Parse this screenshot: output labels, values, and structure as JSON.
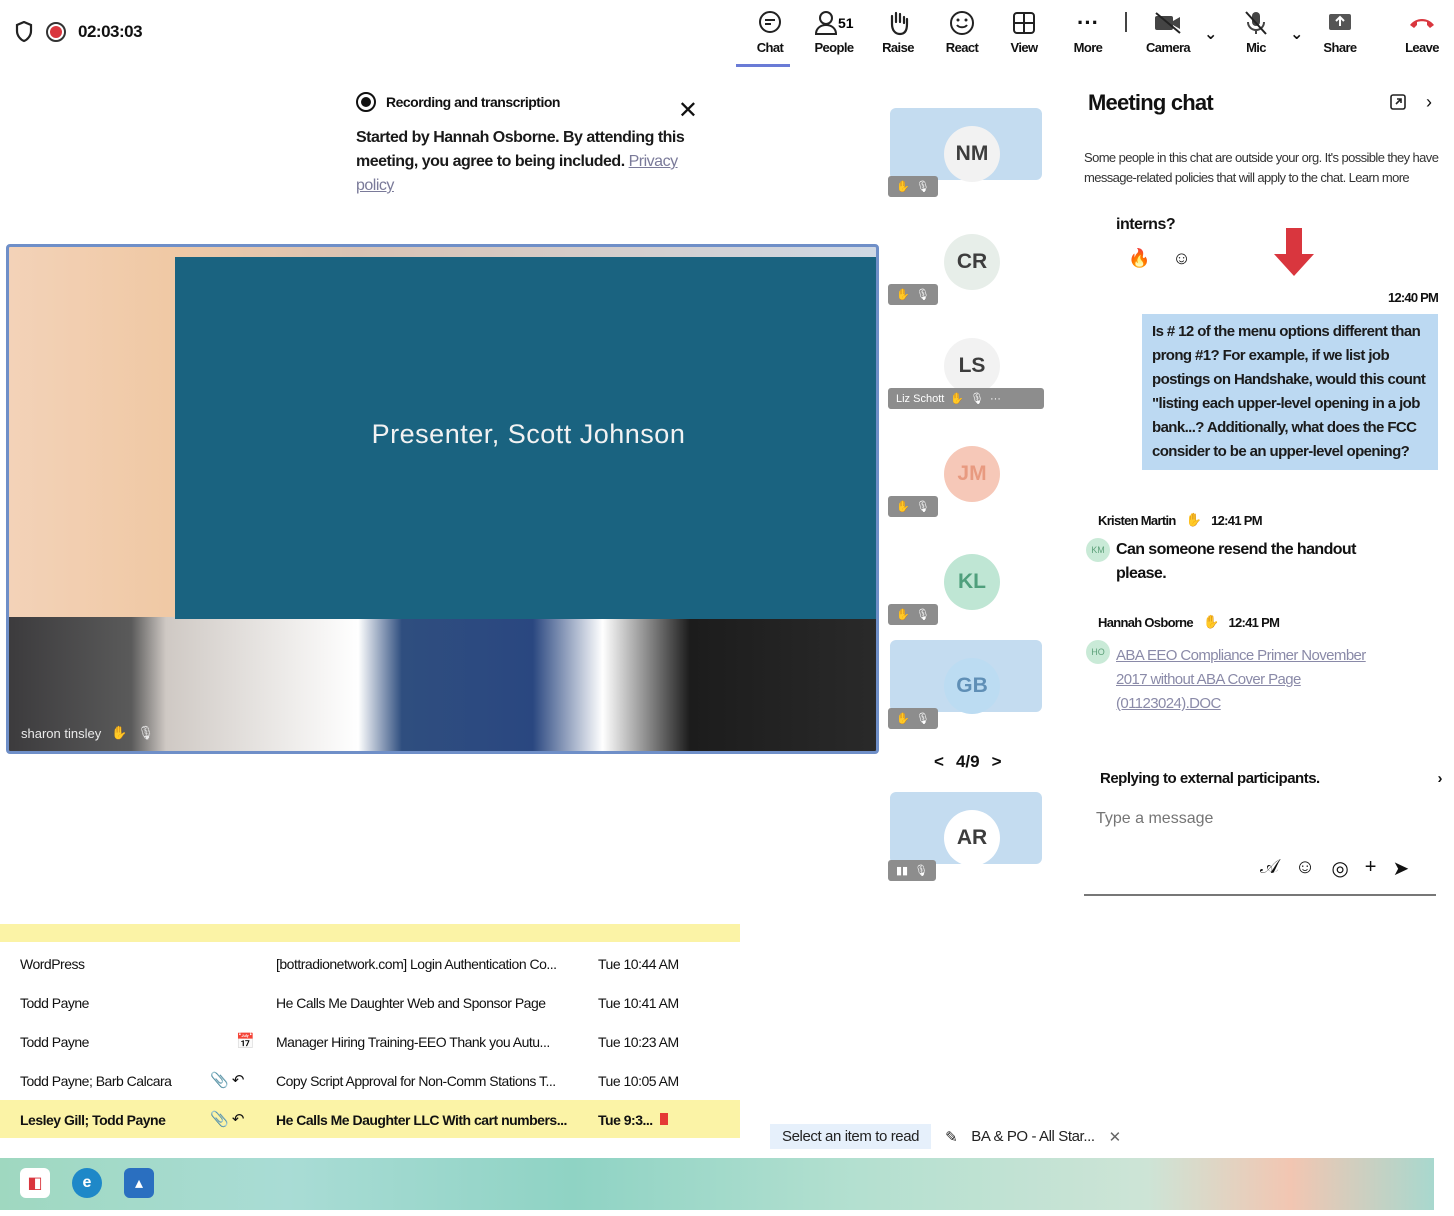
{
  "topbar": {
    "timer": "02:03:03",
    "buttons": [
      {
        "label": "Chat",
        "icon": "chat-icon",
        "glyph": "🗨",
        "badge": ""
      },
      {
        "label": "People",
        "icon": "people-icon",
        "glyph": "👤",
        "badge": "51"
      },
      {
        "label": "Raise",
        "icon": "raise-hand-icon",
        "glyph": "✋",
        "badge": ""
      },
      {
        "label": "React",
        "icon": "react-icon",
        "glyph": "☺",
        "badge": ""
      },
      {
        "label": "View",
        "icon": "view-icon",
        "glyph": "⊞",
        "badge": ""
      },
      {
        "label": "More",
        "icon": "more-icon",
        "glyph": "···",
        "badge": ""
      },
      {
        "label": "Camera",
        "icon": "camera-off-icon",
        "glyph": "■",
        "badge": ""
      },
      {
        "label": "Mic",
        "icon": "mic-off-icon",
        "glyph": "🎙",
        "badge": ""
      },
      {
        "label": "Share",
        "icon": "share-icon",
        "glyph": "⬆",
        "badge": ""
      },
      {
        "label": "Leave",
        "icon": "leave-icon",
        "glyph": "☎",
        "badge": ""
      }
    ]
  },
  "banner": {
    "title": "Recording and transcription",
    "body": "Started by Hannah Osborne. By attending this meeting, you agree to being included.",
    "link": "Privacy policy"
  },
  "video": {
    "slide_text": "Presenter, Scott Johnson",
    "owner": "sharon tinsley"
  },
  "participants": [
    {
      "initials": "NM",
      "name": "",
      "color": "#f2f2f2",
      "bg": "#c4dcf0"
    },
    {
      "initials": "CR",
      "name": "",
      "color": "#e7eee9",
      "bg": "#ffffff"
    },
    {
      "initials": "LS",
      "name": "Liz Schott",
      "color": "#f2f2f2",
      "bg": "#ffffff"
    },
    {
      "initials": "JM",
      "name": "",
      "color": "#f6c8b8",
      "bg": "#ffffff"
    },
    {
      "initials": "KL",
      "name": "",
      "color": "#bfe6d4",
      "bg": "#ffffff"
    },
    {
      "initials": "GB",
      "name": "",
      "color": "#bcdcf2",
      "bg": "#c4dcf0"
    }
  ],
  "pager": {
    "prev": "<",
    "label": "4/9",
    "next": ">"
  },
  "extra_participant": {
    "initials": "AR",
    "bg": "#c4dcf0"
  },
  "chat": {
    "title": "Meeting chat",
    "notice": "Some people in this chat are outside your org. It's possible they have message-related policies that will apply to the chat. Learn more",
    "prev_message": "interns?",
    "time_self": "12:40 PM",
    "self_message": "Is # 12 of the menu options different than prong #1? For example, if we list job postings on Handshake, would this count \"listing each upper-level opening in a job bank...? Additionally, what does the FCC consider to be an upper-level opening?",
    "messages": [
      {
        "sender": "Kristen Martin",
        "time": "12:41 PM",
        "initials": "KM",
        "text": "Can someone resend the handout please."
      },
      {
        "sender": "Hannah Osborne",
        "time": "12:41 PM",
        "initials": "HO",
        "text": "ABA EEO Compliance Primer November 2017 without ABA Cover Page (01123024).DOC"
      }
    ],
    "reply_notice": "Replying to external participants.",
    "input_placeholder": "Type a message"
  },
  "email": {
    "rows": [
      {
        "from": "WordPress",
        "subject": "[bottradionetwork.com] Login Authentication Co...",
        "date": "Tue 10:44 AM",
        "highlight": false,
        "flags": ""
      },
      {
        "from": "Todd Payne",
        "subject": "He Calls Me Daughter Web and Sponsor Page",
        "date": "Tue 10:41 AM",
        "highlight": false,
        "flags": ""
      },
      {
        "from": "Todd Payne",
        "subject": "Manager Hiring Training-EEO   Thank you Autu...",
        "date": "Tue 10:23 AM",
        "highlight": false,
        "flags": "📅"
      },
      {
        "from": "Todd Payne; Barb Calcara",
        "subject": "Copy Script Approval for Non-Comm Stations  T...",
        "date": "Tue 10:05 AM",
        "highlight": false,
        "flags": "📎 ↶"
      },
      {
        "from": "Lesley Gill; Todd Payne",
        "subject": "He Calls Me Daughter LLC   With cart numbers...",
        "date": "Tue 9:3...",
        "highlight": true,
        "flags": "📎 ↶"
      }
    ]
  },
  "reading_pane": {
    "select_text": "Select an item to read",
    "tab_label": "BA & PO - All Star..."
  }
}
